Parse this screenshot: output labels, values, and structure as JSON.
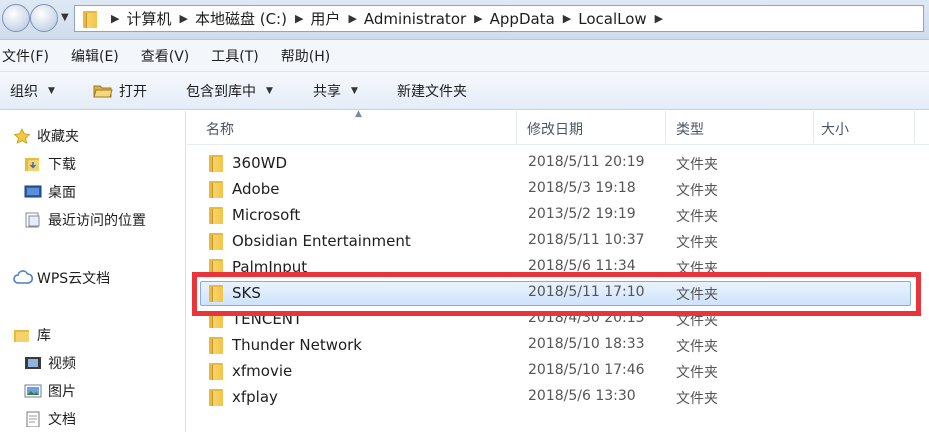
{
  "address_bar": {
    "crumbs": [
      "计算机",
      "本地磁盘 (C:)",
      "用户",
      "Administrator",
      "AppData",
      "LocalLow"
    ]
  },
  "menubar": [
    "文件(F)",
    "编辑(E)",
    "查看(V)",
    "工具(T)",
    "帮助(H)"
  ],
  "toolbar": {
    "organize": "组织",
    "open": "打开",
    "include_library": "包含到库中",
    "share": "共享",
    "new_folder": "新建文件夹"
  },
  "sidebar": {
    "favorites": "收藏夹",
    "downloads": "下载",
    "desktop": "桌面",
    "recent": "最近访问的位置",
    "wps": "WPS云文档",
    "libraries": "库",
    "videos": "视频",
    "pictures": "图片",
    "documents": "文档"
  },
  "columns": {
    "name": "名称",
    "modified": "修改日期",
    "type": "类型",
    "size": "大小"
  },
  "files": [
    {
      "name": "360WD",
      "date": "2018/5/11 20:19",
      "type": "文件夹"
    },
    {
      "name": "Adobe",
      "date": "2018/5/3 19:18",
      "type": "文件夹"
    },
    {
      "name": "Microsoft",
      "date": "2013/5/2 19:19",
      "type": "文件夹"
    },
    {
      "name": "Obsidian Entertainment",
      "date": "2018/5/11 10:37",
      "type": "文件夹"
    },
    {
      "name": "PalmInput",
      "date": "2018/5/6 11:34",
      "type": "文件夹"
    },
    {
      "name": "SKS",
      "date": "2018/5/11 17:10",
      "type": "文件夹",
      "selected": true
    },
    {
      "name": "TENCENT",
      "date": "2018/4/30 20:13",
      "type": "文件夹"
    },
    {
      "name": "Thunder Network",
      "date": "2018/5/10 18:33",
      "type": "文件夹"
    },
    {
      "name": "xfmovie",
      "date": "2018/5/10 17:46",
      "type": "文件夹"
    },
    {
      "name": "xfplay",
      "date": "2018/5/6 13:30",
      "type": "文件夹"
    }
  ],
  "colors": {
    "highlight_border": "#e8343b",
    "folder": "#f3c548",
    "selection": "#cfe3fb"
  }
}
